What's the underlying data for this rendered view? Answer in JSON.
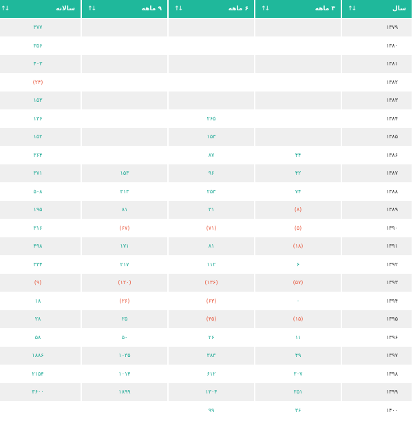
{
  "header": {
    "year": "سال",
    "q3": "۳ ماهه",
    "q6": "۶ ماهه",
    "q9": "۹ ماهه",
    "annual": "سالانه",
    "sort_glyph": "↓↑"
  },
  "colors": {
    "header_bg": "#1fb89b",
    "positive": "#1aa894",
    "negative": "#e8573c",
    "stripe": "#efefef"
  },
  "rows": [
    {
      "year": "۱۳۷۹",
      "q3": "",
      "q6": "",
      "q9": "",
      "annual": "۳۷۷"
    },
    {
      "year": "۱۳۸۰",
      "q3": "",
      "q6": "",
      "q9": "",
      "annual": "۳۵۶"
    },
    {
      "year": "۱۳۸۱",
      "q3": "",
      "q6": "",
      "q9": "",
      "annual": "۴۰۳"
    },
    {
      "year": "۱۳۸۲",
      "q3": "",
      "q6": "",
      "q9": "",
      "annual": "(۲۴)"
    },
    {
      "year": "۱۳۸۳",
      "q3": "",
      "q6": "",
      "q9": "",
      "annual": "۱۵۳"
    },
    {
      "year": "۱۳۸۴",
      "q3": "",
      "q6": "۲۶۵",
      "q9": "",
      "annual": "۱۳۶"
    },
    {
      "year": "۱۳۸۵",
      "q3": "",
      "q6": "۱۵۳",
      "q9": "",
      "annual": "۱۵۲"
    },
    {
      "year": "۱۳۸۶",
      "q3": "۴۴",
      "q6": "۸۷",
      "q9": "",
      "annual": "۳۶۴"
    },
    {
      "year": "۱۳۸۷",
      "q3": "۴۲",
      "q6": "۹۶",
      "q9": "۱۵۳",
      "annual": "۳۷۱"
    },
    {
      "year": "۱۳۸۸",
      "q3": "۷۴",
      "q6": "۲۵۳",
      "q9": "۳۱۳",
      "annual": "۵۰۸"
    },
    {
      "year": "۱۳۸۹",
      "q3": "(۸)",
      "q6": "۳۱",
      "q9": "۸۱",
      "annual": "۱۹۵"
    },
    {
      "year": "۱۳۹۰",
      "q3": "(۵)",
      "q6": "(۷۱)",
      "q9": "(۶۷)",
      "annual": "۳۱۶"
    },
    {
      "year": "۱۳۹۱",
      "q3": "(۱۸)",
      "q6": "۸۱",
      "q9": "۱۷۱",
      "annual": "۴۹۸"
    },
    {
      "year": "۱۳۹۲",
      "q3": "۶",
      "q6": "۱۱۲",
      "q9": "۲۱۷",
      "annual": "۳۳۴"
    },
    {
      "year": "۱۳۹۳",
      "q3": "(۵۷)",
      "q6": "(۱۳۶)",
      "q9": "(۱۲۰)",
      "annual": "(۹)"
    },
    {
      "year": "۱۳۹۴",
      "q3": "۰",
      "q6": "(۶۳)",
      "q9": "(۲۶)",
      "annual": "۱۸"
    },
    {
      "year": "۱۳۹۵",
      "q3": "(۱۵)",
      "q6": "(۴۵)",
      "q9": "۲۵",
      "annual": "۲۸"
    },
    {
      "year": "۱۳۹۶",
      "q3": "۱۱",
      "q6": "۲۶",
      "q9": "۵۰",
      "annual": "۵۸"
    },
    {
      "year": "۱۳۹۷",
      "q3": "۴۹",
      "q6": "۳۸۳",
      "q9": "۱۰۳۵",
      "annual": "۱۸۸۶"
    },
    {
      "year": "۱۳۹۸",
      "q3": "۲۰۷",
      "q6": "۶۱۲",
      "q9": "۱۰۱۴",
      "annual": "۲۱۵۴"
    },
    {
      "year": "۱۳۹۹",
      "q3": "۲۵۱",
      "q6": "۱۳۰۴",
      "q9": "۱۸۹۹",
      "annual": "۳۶۰۰"
    },
    {
      "year": "۱۴۰۰",
      "q3": "۳۶",
      "q6": "۹۹",
      "q9": "",
      "annual": ""
    }
  ]
}
